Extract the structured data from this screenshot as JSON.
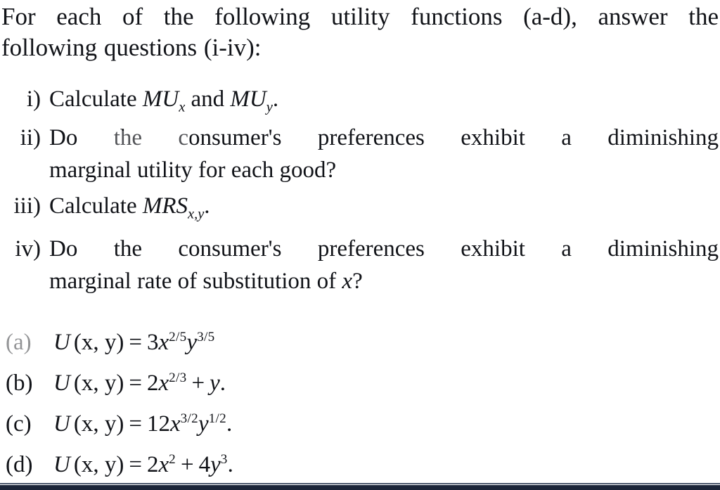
{
  "document": {
    "type": "scanned-textbook-problem",
    "background_color": "#ffffff",
    "text_color": "#111318",
    "bottom_band_color": "#1b2538"
  },
  "intro": {
    "line1": "For each of the following utility functions (a-d), answer the",
    "line2": "following questions (i-iv):"
  },
  "questions": [
    {
      "label": "i)",
      "line1_prefix": "Calculate ",
      "mu_x": {
        "base": "MU",
        "sub": "x"
      },
      "conjunction": " and ",
      "mu_y": {
        "base": "MU",
        "sub": "y"
      },
      "terminator": "."
    },
    {
      "label": "ii)",
      "line1": "Do the consumer's preferences exhibit a diminishing",
      "line2": "marginal utility for each good?"
    },
    {
      "label": "iii)",
      "line1_prefix": "Calculate ",
      "mrs": {
        "base": "MRS",
        "sub": "x,y"
      },
      "terminator": "."
    },
    {
      "label": "iv)",
      "line1": "Do the consumer's preferences exhibit a diminishing",
      "line2_prefix": "marginal rate of substitution of ",
      "line2_var": "x",
      "line2_suffix": "?"
    }
  ],
  "functions": [
    {
      "label": "(a)",
      "name": "U",
      "args": "(x, y)",
      "equals": "=",
      "coefficient": "3",
      "x_var": "x",
      "x_exponent": "2/5",
      "y_var": "y",
      "y_exponent": "3/5",
      "terminator": "",
      "latex": "U(x,y) = 3x^{2/5}y^{3/5}"
    },
    {
      "label": "(b)",
      "name": "U",
      "args": "(x, y)",
      "equals": "=",
      "coefficient": "2",
      "x_var": "x",
      "x_exponent": "2/3",
      "operator": "+",
      "y_var": "y",
      "y_exponent": "",
      "terminator": ".",
      "latex": "U(x,y) = 2x^{2/3} + y."
    },
    {
      "label": "(c)",
      "name": "U",
      "args": "(x, y)",
      "equals": "=",
      "coefficient": "12",
      "x_var": "x",
      "x_exponent": "3/2",
      "y_var": "y",
      "y_exponent": "1/2",
      "terminator": ".",
      "latex": "U(x,y) = 12x^{3/2}y^{1/2}."
    },
    {
      "label": "(d)",
      "name": "U",
      "args": "(x, y)",
      "equals": "=",
      "coefficient": "2",
      "x_var": "x",
      "x_exponent": "2",
      "operator": "+",
      "y_coefficient": "4",
      "y_var": "y",
      "y_exponent": "3",
      "terminator": ".",
      "latex": "U(x,y) = 2x^2 + 4y^3."
    }
  ]
}
